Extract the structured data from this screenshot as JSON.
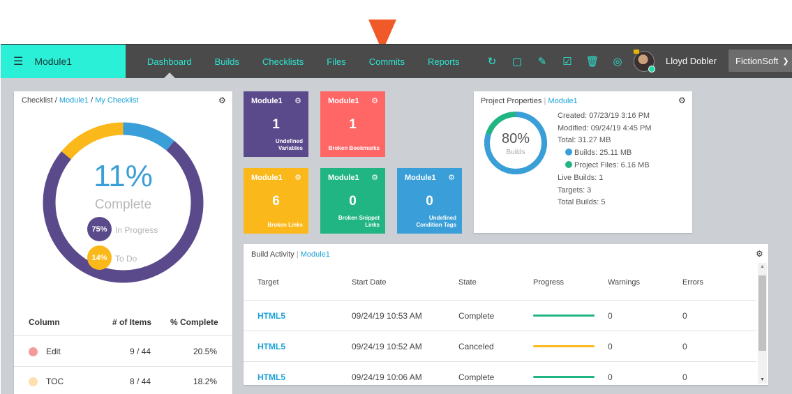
{
  "topbar": {
    "module": "Module1",
    "nav": [
      "Dashboard",
      "Builds",
      "Checklists",
      "Files",
      "Commits",
      "Reports"
    ],
    "user": "Lloyd Dobler",
    "org": "FictionSoft",
    "colors": {
      "accent": "#2af0d8",
      "pointer": "#f05a28",
      "bar": "#4a4a4a"
    }
  },
  "checklist": {
    "crumb_root": "Checklist",
    "crumb_module": "Module1",
    "crumb_item": "My Checklist",
    "percent": "11%",
    "complete_label": "Complete",
    "segments": {
      "complete": 11,
      "in_progress": 14,
      "to_do": 75
    },
    "legend": [
      {
        "value": "75%",
        "label": "In Progress",
        "color": "#5b4a8b"
      },
      {
        "value": "14%",
        "label": "To Do",
        "color": "#fbb81b"
      }
    ],
    "table": {
      "headers": [
        "Column",
        "# of Items",
        "% Complete"
      ],
      "rows": [
        {
          "color": "#f59a9a",
          "name": "Edit",
          "items": "9 / 44",
          "pct": "20.5%"
        },
        {
          "color": "#fde0b0",
          "name": "TOC",
          "items": "8 / 44",
          "pct": "18.2%"
        }
      ]
    }
  },
  "tiles": [
    {
      "title": "Module1",
      "value": "1",
      "label1": "Undefined",
      "label2": "Variables",
      "color": "#5b4a8b"
    },
    {
      "title": "Module1",
      "value": "1",
      "label1": "",
      "label2": "Broken Bookmarks",
      "color": "#ff6767"
    },
    {
      "title": "Module1",
      "value": "6",
      "label1": "",
      "label2": "Broken Links",
      "color": "#fbb81b"
    },
    {
      "title": "Module1",
      "value": "0",
      "label1": "Broken Snippet",
      "label2": "Links",
      "color": "#22b584"
    },
    {
      "title": "Module1",
      "value": "0",
      "label1": "Undefined",
      "label2": "Condition Tags",
      "color": "#3a9fd8"
    }
  ],
  "project": {
    "title": "Project Properties",
    "module": "Module1",
    "percent": "80%",
    "sub": "Builds",
    "ring_fill": 80,
    "created": "Created: 07/23/19 3:16 PM",
    "modified": "Modified: 09/24/19 4:45 PM",
    "total": "Total: 31.27 MB",
    "builds": "Builds: 25.11 MB",
    "files": "Project Files: 6.16 MB",
    "live": "Live Builds: 1",
    "targets": "Targets: 3",
    "total_builds": "Total Builds: 5"
  },
  "activity": {
    "title": "Build Activity",
    "module": "Module1",
    "headers": [
      "Target",
      "Start Date",
      "State",
      "Progress",
      "Warnings",
      "Errors"
    ],
    "rows": [
      {
        "target": "HTML5",
        "date": "09/24/19 10:53 AM",
        "state": "Complete",
        "progress": 100,
        "color": "#22b584",
        "warnings": "0",
        "errors": "0"
      },
      {
        "target": "HTML5",
        "date": "09/24/19 10:52 AM",
        "state": "Canceled",
        "progress": 100,
        "color": "#fbb81b",
        "warnings": "0",
        "errors": "0"
      },
      {
        "target": "HTML5",
        "date": "09/24/19 10:06 AM",
        "state": "Complete",
        "progress": 100,
        "color": "#22b584",
        "warnings": "0",
        "errors": "0"
      }
    ]
  }
}
